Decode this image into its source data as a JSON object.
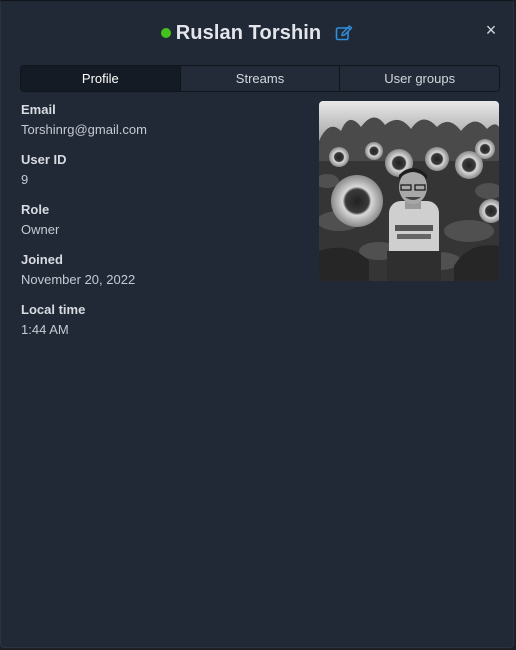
{
  "header": {
    "presence_color": "#44c21d",
    "user_name": "Ruslan Torshin",
    "edit_icon": "edit-icon",
    "close_label": "×"
  },
  "tabs": [
    {
      "label": "Profile",
      "active": true
    },
    {
      "label": "Streams",
      "active": false
    },
    {
      "label": "User groups",
      "active": false
    }
  ],
  "fields": [
    {
      "label": "Email",
      "value": "Torshinrg@gmail.com"
    },
    {
      "label": "User ID",
      "value": "9"
    },
    {
      "label": "Role",
      "value": "Owner"
    },
    {
      "label": "Joined",
      "value": "November 20, 2022"
    },
    {
      "label": "Local time",
      "value": "1:44 AM"
    }
  ],
  "avatar": {
    "description": "black-and-white photo of a man among sunflowers"
  },
  "colors": {
    "accent": "#2f8fdd",
    "background": "#212937",
    "active_tab": "#151b24"
  }
}
